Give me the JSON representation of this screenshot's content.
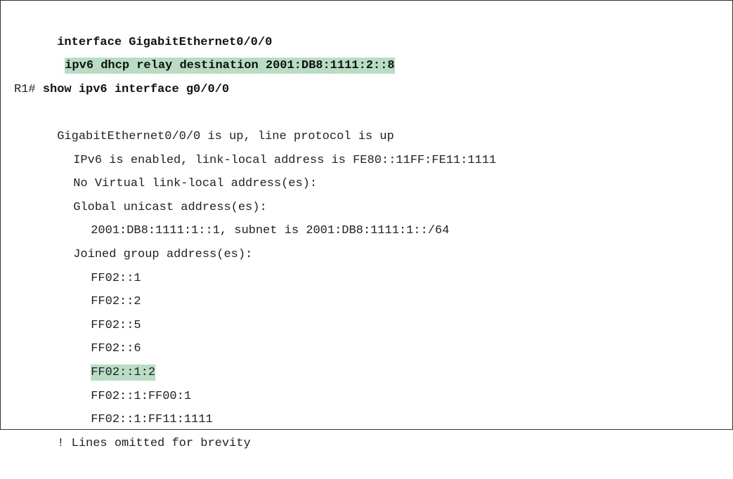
{
  "config": {
    "interface_line": "interface GigabitEthernet0/0/0",
    "relay_line": "ipv6 dhcp relay destination 2001:DB8:1111:2::8"
  },
  "command": {
    "prompt": "R1# ",
    "text": "show ipv6 interface g0/0/0"
  },
  "output": {
    "status": "GigabitEthernet0/0/0 is up, line protocol is up",
    "ipv6_enabled": "IPv6 is enabled, link-local address is FE80::11FF:FE11:1111",
    "virtual_ll": "No Virtual link-local address(es):",
    "global_unicast_header": "Global unicast address(es):",
    "global_unicast_address": "2001:DB8:1111:1::1, subnet is 2001:DB8:1111:1::/64",
    "joined_header": "Joined group address(es):",
    "groups": [
      "FF02::1",
      "FF02::2",
      "FF02::5",
      "FF02::6",
      "FF02::1:2",
      "FF02::1:FF00:1",
      "FF02::1:FF11:1111"
    ],
    "omitted": "! Lines omitted for brevity"
  },
  "colors": {
    "highlight": "#b9dcc4"
  }
}
